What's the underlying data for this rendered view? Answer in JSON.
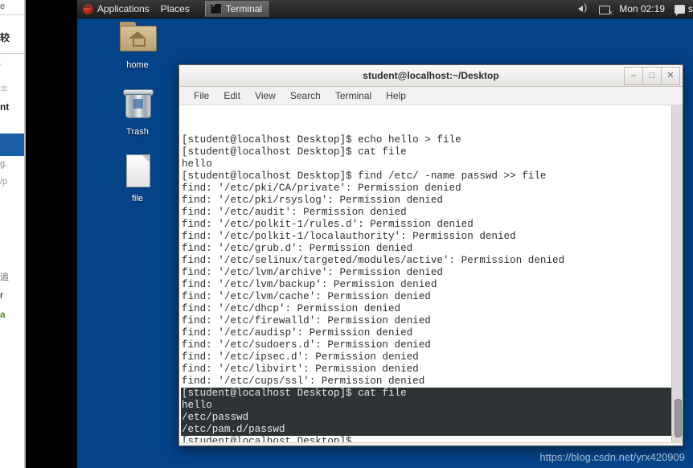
{
  "panel": {
    "redhat_icon": "redhat-logo-icon",
    "applications": "Applications",
    "places": "Places",
    "task_terminal": "Terminal",
    "task_terminal_icon": "terminal-icon",
    "volume_icon": "volume-icon",
    "network_icon": "network-disconnected-icon",
    "clock": "Mon 02:19",
    "message_icon": "message-tray-icon",
    "user": "s"
  },
  "desktop": {
    "background_color": "#054388",
    "icons": [
      {
        "name": "home",
        "label": "home",
        "icon": "home-folder-icon"
      },
      {
        "name": "trash",
        "label": "Trash",
        "icon": "trash-icon"
      },
      {
        "name": "file",
        "label": "file",
        "icon": "text-file-icon"
      }
    ]
  },
  "terminal": {
    "title": "student@localhost:~/Desktop",
    "controls": {
      "minimize": "–",
      "maximize": "□",
      "close": "✕"
    },
    "menu": [
      "File",
      "Edit",
      "View",
      "Search",
      "Terminal",
      "Help"
    ],
    "selection_color": "#2e3436",
    "lines": [
      {
        "text": "",
        "selected": false
      },
      {
        "text": "",
        "selected": false
      },
      {
        "text": "[student@localhost Desktop]$ echo hello > file",
        "selected": false
      },
      {
        "text": "[student@localhost Desktop]$ cat file",
        "selected": false
      },
      {
        "text": "hello",
        "selected": false
      },
      {
        "text": "[student@localhost Desktop]$ find /etc/ -name passwd >> file",
        "selected": false
      },
      {
        "text": "find: '/etc/pki/CA/private': Permission denied",
        "selected": false
      },
      {
        "text": "find: '/etc/pki/rsyslog': Permission denied",
        "selected": false
      },
      {
        "text": "find: '/etc/audit': Permission denied",
        "selected": false
      },
      {
        "text": "find: '/etc/polkit-1/rules.d': Permission denied",
        "selected": false
      },
      {
        "text": "find: '/etc/polkit-1/localauthority': Permission denied",
        "selected": false
      },
      {
        "text": "find: '/etc/grub.d': Permission denied",
        "selected": false
      },
      {
        "text": "find: '/etc/selinux/targeted/modules/active': Permission denied",
        "selected": false
      },
      {
        "text": "find: '/etc/lvm/archive': Permission denied",
        "selected": false
      },
      {
        "text": "find: '/etc/lvm/backup': Permission denied",
        "selected": false
      },
      {
        "text": "find: '/etc/lvm/cache': Permission denied",
        "selected": false
      },
      {
        "text": "find: '/etc/dhcp': Permission denied",
        "selected": false
      },
      {
        "text": "find: '/etc/firewalld': Permission denied",
        "selected": false
      },
      {
        "text": "find: '/etc/audisp': Permission denied",
        "selected": false
      },
      {
        "text": "find: '/etc/sudoers.d': Permission denied",
        "selected": false
      },
      {
        "text": "find: '/etc/ipsec.d': Permission denied",
        "selected": false
      },
      {
        "text": "find: '/etc/libvirt': Permission denied",
        "selected": false
      },
      {
        "text": "find: '/etc/cups/ssl': Permission denied",
        "selected": false
      },
      {
        "text": "[student@localhost Desktop]$ cat file",
        "selected": true
      },
      {
        "text": "hello",
        "selected": true
      },
      {
        "text": "/etc/passwd",
        "selected": true
      },
      {
        "text": "/etc/pam.d/passwd",
        "selected": true
      },
      {
        "text": "[student@localhost Desktop]$ ",
        "selected": false
      }
    ]
  },
  "background_window": {
    "line_a": "e",
    "line_b": "较",
    "line_c": "‘",
    "line_d": "本",
    "line_e": "nt",
    "line_f": "g.",
    "line_g": "/p",
    "line_h": "追",
    "line_i": "r",
    "line_j": "a"
  },
  "watermark": "https://blog.csdn.net/yrx420909"
}
